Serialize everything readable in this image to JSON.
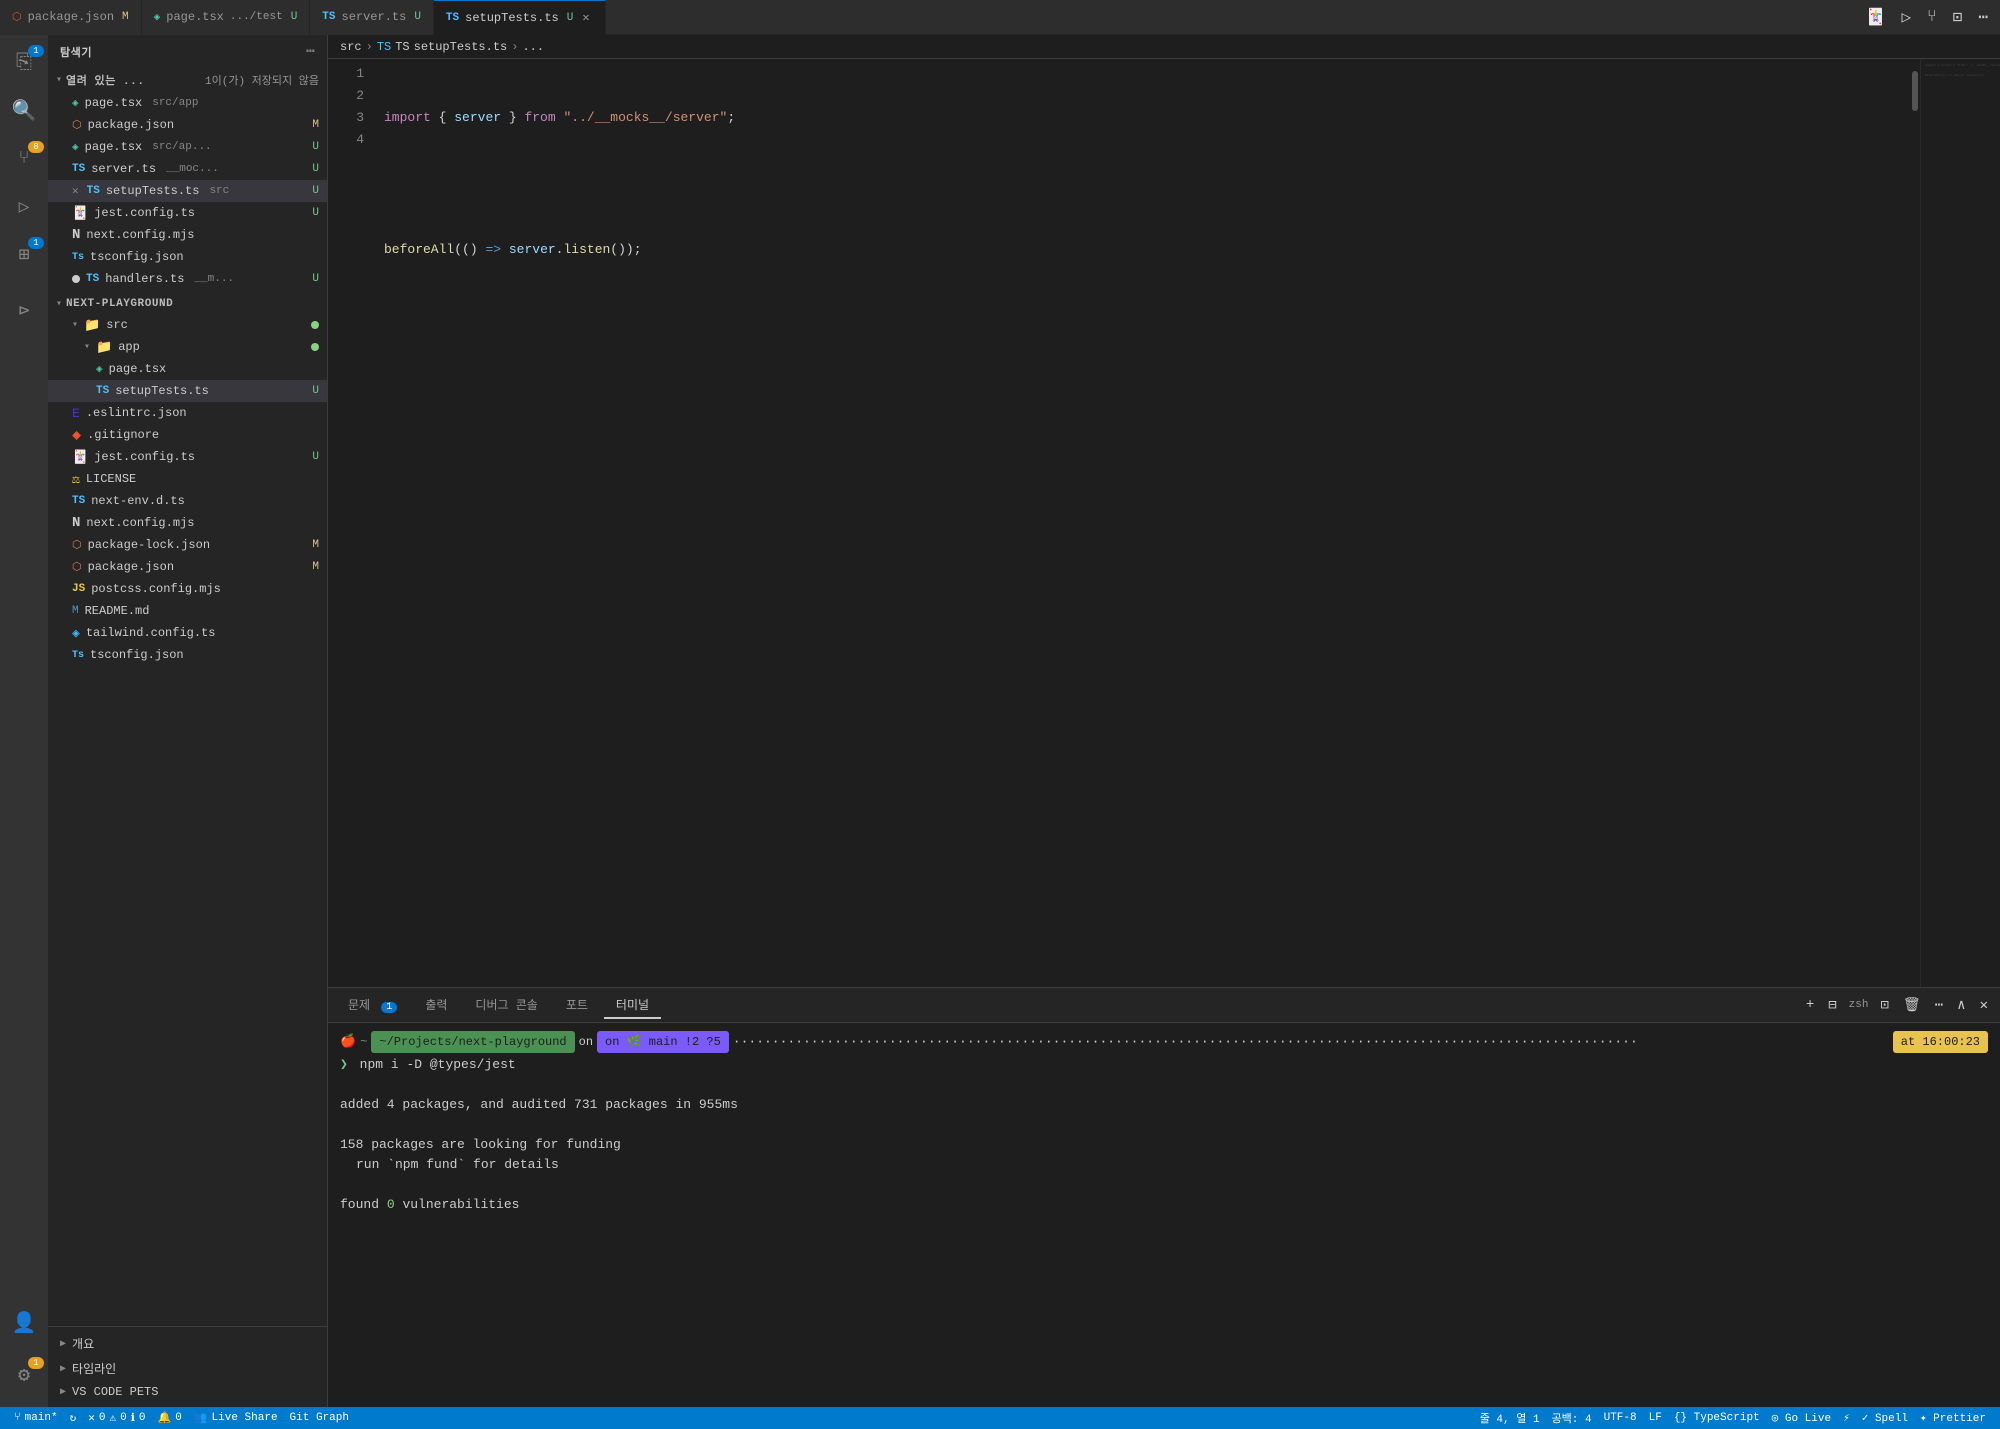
{
  "tabbar": {
    "tabs": [
      {
        "id": "package-json",
        "icon": "json",
        "name": "package.json",
        "badge": "M",
        "active": false
      },
      {
        "id": "page-tsx",
        "icon": "tsx",
        "name": "page.tsx",
        "path": ".../test",
        "badge": "U",
        "active": false
      },
      {
        "id": "server-ts",
        "icon": "ts",
        "name": "server.ts",
        "badge": "U",
        "active": false
      },
      {
        "id": "setup-tests",
        "icon": "ts",
        "name": "setupTests.ts",
        "badge": "U",
        "active": true,
        "closeable": true
      }
    ],
    "actions": [
      "jest-icon",
      "run-icon",
      "branch-icon",
      "layout-icon",
      "more-icon"
    ]
  },
  "breadcrumb": {
    "parts": [
      "src",
      "TS",
      "setupTests.ts",
      "..."
    ]
  },
  "code": {
    "lines": [
      {
        "num": 1,
        "content": "import { server } from \"../__mocks__/server\";"
      },
      {
        "num": 2,
        "content": ""
      },
      {
        "num": 3,
        "content": "beforeAll(() => server.listen());"
      },
      {
        "num": 4,
        "content": ""
      }
    ]
  },
  "sidebar": {
    "header": "탐색기",
    "open_files_label": "열려 있는 ...",
    "open_files_count": "1이(가) 저장되지 않음",
    "open_files": [
      {
        "icon": "tsx",
        "name": "page.tsx",
        "path": "src/app",
        "badge": ""
      },
      {
        "icon": "json-red",
        "name": "package.json",
        "badge": "M"
      },
      {
        "icon": "tsx",
        "name": "page.tsx",
        "path": "src/ap...",
        "badge": "U"
      },
      {
        "icon": "ts",
        "name": "server.ts",
        "path": "__moc...",
        "badge": "U"
      },
      {
        "icon": "ts-close",
        "name": "setupTests.ts",
        "path": "src",
        "badge": "U",
        "active": true
      },
      {
        "icon": "jest",
        "name": "jest.config.ts",
        "badge": "U"
      },
      {
        "icon": "next",
        "name": "next.config.mjs",
        "badge": ""
      },
      {
        "icon": "ts-small",
        "name": "tsconfig.json",
        "badge": ""
      },
      {
        "icon": "dot",
        "name": "handlers.ts",
        "path": "__m...",
        "badge": "U"
      }
    ],
    "project_name": "NEXT-PLAYGROUND",
    "tree": [
      {
        "type": "folder",
        "name": "src",
        "level": 0,
        "open": true,
        "dot": true
      },
      {
        "type": "folder",
        "name": "app",
        "level": 1,
        "open": true,
        "dot": true
      },
      {
        "type": "file",
        "icon": "tsx",
        "name": "page.tsx",
        "level": 2
      },
      {
        "type": "file",
        "icon": "ts",
        "name": "setupTests.ts",
        "level": 2,
        "badge": "U",
        "active": true
      },
      {
        "type": "file",
        "icon": "eslint",
        "name": ".eslintrc.json",
        "level": 0
      },
      {
        "type": "file",
        "icon": "git",
        "name": ".gitignore",
        "level": 0
      },
      {
        "type": "file",
        "icon": "jest",
        "name": "jest.config.ts",
        "level": 0,
        "badge": "U"
      },
      {
        "type": "file",
        "icon": "license",
        "name": "LICENSE",
        "level": 0
      },
      {
        "type": "file",
        "icon": "ts",
        "name": "next-env.d.ts",
        "level": 0
      },
      {
        "type": "file",
        "icon": "next",
        "name": "next.config.mjs",
        "level": 0
      },
      {
        "type": "file",
        "icon": "json-red",
        "name": "package-lock.json",
        "level": 0,
        "badge": "M"
      },
      {
        "type": "file",
        "icon": "json-red",
        "name": "package.json",
        "level": 0,
        "badge": "M"
      },
      {
        "type": "file",
        "icon": "js",
        "name": "postcss.config.mjs",
        "level": 0
      },
      {
        "type": "file",
        "icon": "md",
        "name": "README.md",
        "level": 0
      },
      {
        "type": "file",
        "icon": "tailwind",
        "name": "tailwind.config.ts",
        "level": 0
      },
      {
        "type": "file",
        "icon": "ts-small",
        "name": "tsconfig.json",
        "level": 0
      }
    ],
    "bottom": [
      {
        "label": "개요"
      },
      {
        "label": "타임라인"
      },
      {
        "label": "VS CODE PETS"
      }
    ]
  },
  "terminal": {
    "tabs": [
      {
        "label": "문제",
        "badge": "1",
        "active": false
      },
      {
        "label": "출력",
        "active": false
      },
      {
        "label": "디버그 콘솔",
        "active": false
      },
      {
        "label": "포트",
        "active": false
      },
      {
        "label": "터미널",
        "active": true
      }
    ],
    "shell": "zsh",
    "prompt_path": "~/Projects/next-playground",
    "prompt_branch": "on 🌿 main !2 ?5",
    "prompt_time": "at 16:00:23",
    "command": "npm i -D @types/jest",
    "output": [
      "",
      "added 4 packages, and audited 731 packages in 955ms",
      "",
      "158 packages are looking for funding",
      "  run `npm fund` for details",
      "",
      "found 0 vulnerabilities"
    ]
  },
  "statusbar": {
    "left": [
      {
        "icon": "branch",
        "label": "main*",
        "id": "branch"
      },
      {
        "icon": "sync",
        "label": "",
        "id": "sync"
      },
      {
        "icon": "error",
        "label": "0",
        "id": "errors"
      },
      {
        "icon": "warning",
        "label": "0",
        "id": "warnings"
      },
      {
        "icon": "info",
        "label": "0",
        "id": "info"
      },
      {
        "icon": "bell",
        "label": "0",
        "id": "bell"
      }
    ],
    "center_left": {
      "label": "Live Share",
      "id": "liveshare"
    },
    "center": {
      "label": "Git Graph",
      "id": "gitgraph"
    },
    "right": [
      {
        "label": "줄 4, 열 1",
        "id": "cursor"
      },
      {
        "label": "공백: 4",
        "id": "spaces"
      },
      {
        "label": "UTF-8",
        "id": "encoding"
      },
      {
        "label": "LF",
        "id": "eol"
      },
      {
        "label": "{} TypeScript",
        "id": "language"
      },
      {
        "label": "◎ Go Live",
        "id": "golive"
      },
      {
        "label": "⚡",
        "id": "lightning"
      },
      {
        "label": "✓ Spell",
        "id": "spell"
      },
      {
        "label": "✦ Prettier",
        "id": "prettier"
      }
    ]
  }
}
